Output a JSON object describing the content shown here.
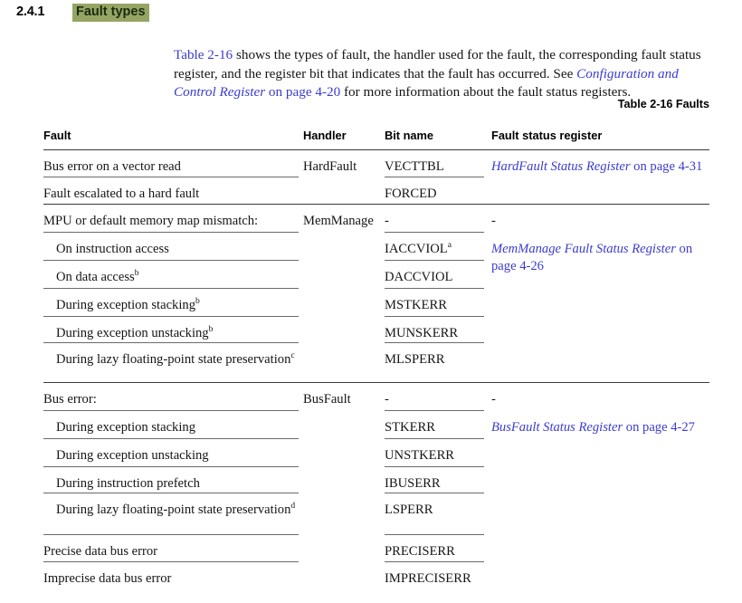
{
  "heading": {
    "number": "2.4.1",
    "title": "Fault types",
    "highlight_color": "#95a563"
  },
  "intro": {
    "link1": "Table 2-16",
    "text1": " shows the types of fault, the handler used for the fault, the corresponding fault status register, and the register bit that indicates that the fault has occurred. See ",
    "link2_italic": "Configuration and Control Register",
    "text2": " on page 4-20",
    "text3": " for more information about the fault status registers.",
    "link_color": "#3b3bd0"
  },
  "table": {
    "caption": "Table 2-16 Faults",
    "headers": {
      "fault": "Fault",
      "handler": "Handler",
      "bit_name": "Bit name",
      "fault_status_register": "Fault status register"
    },
    "rows": [
      {
        "fault": "Bus error on a vector read",
        "handler": "HardFault",
        "bit_name": "VECTTBL",
        "fsr_italic": "HardFault Status Register",
        "fsr_plain": " on page 4-31"
      },
      {
        "fault": "Fault escalated to a hard fault",
        "handler": "",
        "bit_name": "FORCED",
        "fsr_italic": "",
        "fsr_plain": ""
      },
      {
        "fault": "MPU or default memory map mismatch:",
        "handler": "MemManage",
        "bit_name": "-",
        "fsr_italic": "",
        "fsr_plain": "-"
      },
      {
        "fault": "On instruction access",
        "fault_sup": "",
        "handler": "",
        "bit_name": "IACCVIOL",
        "bit_sup": "a",
        "fsr_italic": "MemManage Fault Status Register",
        "fsr_plain": " on page 4-26"
      },
      {
        "fault": "On data access",
        "fault_sup": "b",
        "handler": "",
        "bit_name": "DACCVIOL",
        "fsr_italic": "",
        "fsr_plain": ""
      },
      {
        "fault": "During exception stacking",
        "fault_sup": "b",
        "handler": "",
        "bit_name": "MSTKERR",
        "fsr_italic": "",
        "fsr_plain": ""
      },
      {
        "fault": "During exception unstacking",
        "fault_sup": "b",
        "handler": "",
        "bit_name": "MUNSKERR",
        "fsr_italic": "",
        "fsr_plain": ""
      },
      {
        "fault": "During lazy floating-point state preservation",
        "fault_sup": "c",
        "handler": "",
        "bit_name": "MLSPERR",
        "fsr_italic": "",
        "fsr_plain": ""
      },
      {
        "fault": "Bus error:",
        "handler": "BusFault",
        "bit_name": "-",
        "fsr_italic": "",
        "fsr_plain": "-"
      },
      {
        "fault": "During exception stacking",
        "handler": "",
        "bit_name": "STKERR",
        "fsr_italic": "BusFault Status Register",
        "fsr_plain": " on page 4-27"
      },
      {
        "fault": "During exception unstacking",
        "handler": "",
        "bit_name": "UNSTKERR",
        "fsr_italic": "",
        "fsr_plain": ""
      },
      {
        "fault": "During instruction prefetch",
        "handler": "",
        "bit_name": "IBUSERR",
        "fsr_italic": "",
        "fsr_plain": ""
      },
      {
        "fault": "During lazy floating-point state preservation",
        "fault_sup": "d",
        "handler": "",
        "bit_name": "LSPERR",
        "fsr_italic": "",
        "fsr_plain": ""
      },
      {
        "fault": "Precise data bus error",
        "handler": "",
        "bit_name": "PRECISERR",
        "fsr_italic": "",
        "fsr_plain": ""
      },
      {
        "fault": "Imprecise data bus error",
        "handler": "",
        "bit_name": "IMPRECISERR",
        "fsr_italic": "",
        "fsr_plain": ""
      }
    ]
  }
}
